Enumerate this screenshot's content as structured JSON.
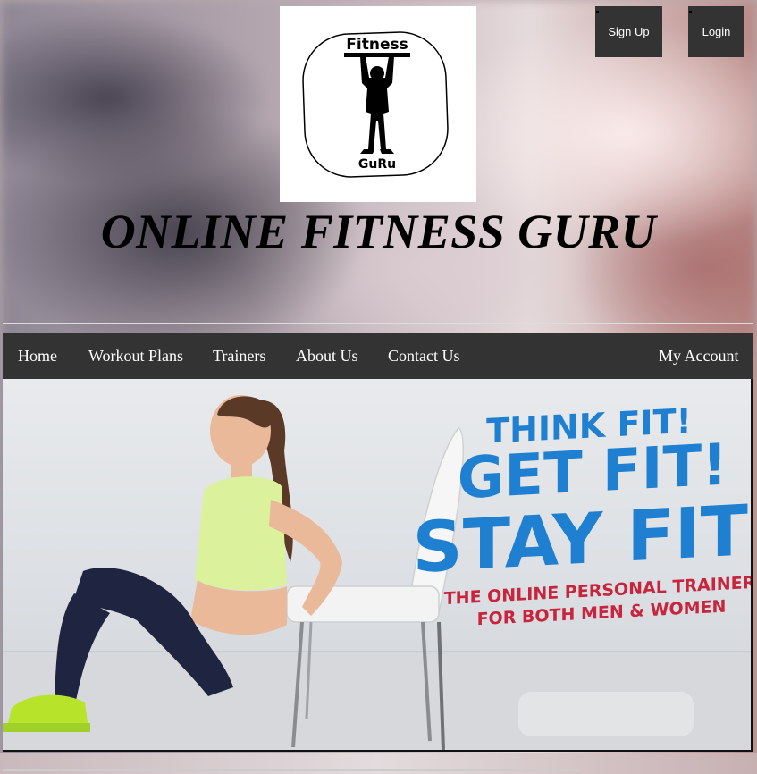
{
  "header": {
    "logo": {
      "top_text": "Fitness",
      "bottom_text": "GuRu"
    },
    "title": "ONLINE FITNESS GURU",
    "buttons": {
      "signup_label": "Sign Up",
      "login_label": "Login"
    }
  },
  "nav": {
    "items": [
      {
        "label": "Home"
      },
      {
        "label": "Workout Plans"
      },
      {
        "label": "Trainers"
      },
      {
        "label": "About Us"
      },
      {
        "label": "Contact Us"
      }
    ],
    "account_label": "My Account"
  },
  "hero": {
    "line1": "THINK FIT!",
    "line2": "GET FIT!",
    "line3": "STAY FIT!",
    "sub1": "THE ONLINE PERSONAL TRAINER",
    "sub2_prefix": "FOR BOTH ",
    "sub2_highlight": "MEN & WOMEN",
    "colors": {
      "headline_blue": "#1f7fd1",
      "subtext_red": "#c8243c",
      "nav_bg": "#333333"
    }
  }
}
